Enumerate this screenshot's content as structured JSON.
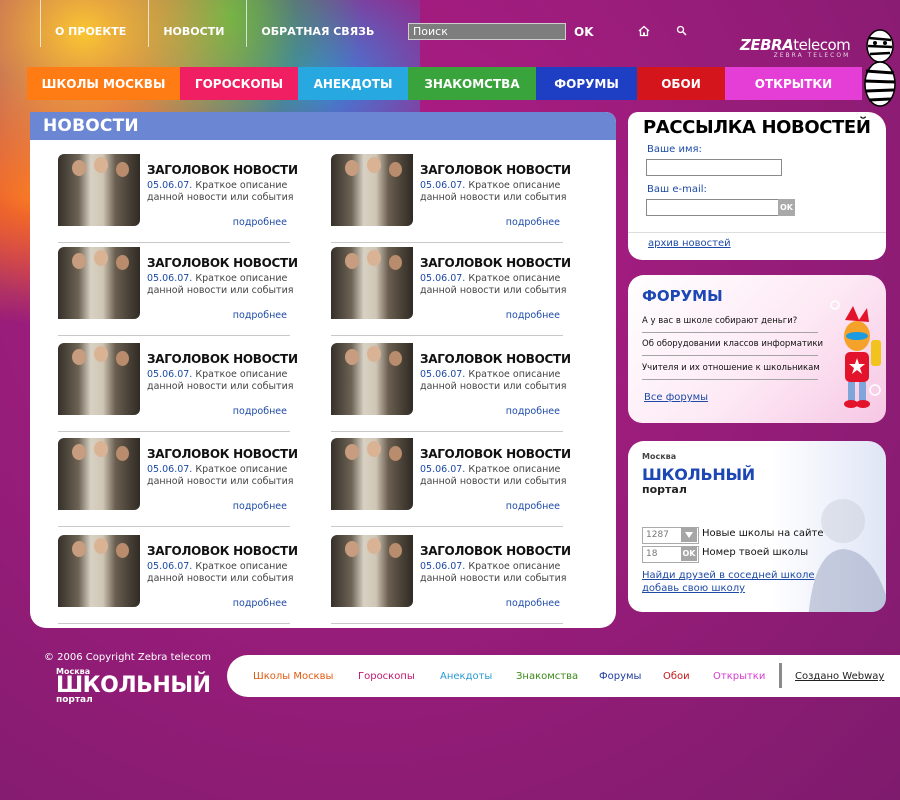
{
  "top_links": [
    "О ПРОЕКТЕ",
    "НОВОСТИ",
    "ОБРАТНАЯ СВЯЗЬ"
  ],
  "search": {
    "placeholder": "Поиск",
    "button": "OK"
  },
  "logo": {
    "brand": "ZEBRA",
    "suffix": "telecom",
    "tagline": "ZEBRA TELECOM"
  },
  "nav": [
    {
      "label": "ШКОЛЫ МОСКВЫ",
      "color": "#ff7c14"
    },
    {
      "label": "ГОРОСКОПЫ",
      "color": "#f01f63"
    },
    {
      "label": "АНЕКДОТЫ",
      "color": "#28a8e0"
    },
    {
      "label": "ЗНАКОМСТВА",
      "color": "#3aa43c"
    },
    {
      "label": "ФОРУМЫ",
      "color": "#1e3fc4"
    },
    {
      "label": "ОБОИ",
      "color": "#d4161c"
    },
    {
      "label": "ОТКРЫТКИ",
      "color": "#e53ed7"
    }
  ],
  "news": {
    "title": "НОВОСТИ",
    "items": [
      {
        "headline": "ЗАГОЛОВОК НОВОСТИ",
        "date": "05.06.07.",
        "desc": "Краткое описание данной новости или события",
        "more": "подробнее"
      },
      {
        "headline": "ЗАГОЛОВОК НОВОСТИ",
        "date": "05.06.07.",
        "desc": "Краткое описание данной новости или события",
        "more": "подробнее"
      },
      {
        "headline": "ЗАГОЛОВОК НОВОСТИ",
        "date": "05.06.07.",
        "desc": "Краткое описание данной новости или события",
        "more": "подробнее"
      },
      {
        "headline": "ЗАГОЛОВОК НОВОСТИ",
        "date": "05.06.07.",
        "desc": "Краткое описание данной новости или события",
        "more": "подробнее"
      },
      {
        "headline": "ЗАГОЛОВОК НОВОСТИ",
        "date": "05.06.07.",
        "desc": "Краткое описание данной новости или события",
        "more": "подробнее"
      },
      {
        "headline": "ЗАГОЛОВОК НОВОСТИ",
        "date": "05.06.07.",
        "desc": "Краткое описание данной новости или события",
        "more": "подробнее"
      },
      {
        "headline": "ЗАГОЛОВОК НОВОСТИ",
        "date": "05.06.07.",
        "desc": "Краткое описание данной новости или события",
        "more": "подробнее"
      },
      {
        "headline": "ЗАГОЛОВОК НОВОСТИ",
        "date": "05.06.07.",
        "desc": "Краткое описание данной новости или события",
        "more": "подробнее"
      },
      {
        "headline": "ЗАГОЛОВОК НОВОСТИ",
        "date": "05.06.07.",
        "desc": "Краткое описание данной новости или события",
        "more": "подробнее"
      },
      {
        "headline": "ЗАГОЛОВОК НОВОСТИ",
        "date": "05.06.07.",
        "desc": "Краткое описание данной новости или события",
        "more": "подробнее"
      }
    ]
  },
  "newsletter": {
    "title": "РАССЫЛКА НОВОСТЕЙ",
    "name_label": "Ваше имя:",
    "email_label": "Ваш e-mail:",
    "button": "OK",
    "archive": "архив новостей"
  },
  "forums": {
    "title": "ФОРУМЫ",
    "topics": [
      "А у вас в школе собирают деньги?",
      "Об оборудовании классов информатики",
      "Учителя и их отношение к школьникам"
    ],
    "all": "Все форумы"
  },
  "portal": {
    "city": "Москва",
    "name1": "ШКОЛЬНЫЙ",
    "name2": "портал",
    "new_schools_value": "1287",
    "new_schools_label": "Новые школы на сайте",
    "school_number_value": "18",
    "school_number_button": "OK",
    "school_number_label": "Номер твоей школы",
    "link1": "Найди друзей в соседней школе",
    "link2": "добавь свою школу"
  },
  "footer": {
    "copyright": "© 2006 Copyright Zebra telecom",
    "logo_city": "Москва",
    "logo_name1": "ШКОЛЬНЫЙ",
    "logo_name2": "портал",
    "links": [
      {
        "label": "Школы Москвы",
        "color": "#e0590f"
      },
      {
        "label": "Гороскопы",
        "color": "#c0176e"
      },
      {
        "label": "Анекдоты",
        "color": "#2a9ad4"
      },
      {
        "label": "Знакомства",
        "color": "#3b8a1a"
      },
      {
        "label": "Форумы",
        "color": "#1f3ba0"
      },
      {
        "label": "Обои",
        "color": "#c3151b"
      },
      {
        "label": "Открытки",
        "color": "#d63bd0"
      }
    ],
    "credit": "Создано Webway"
  }
}
